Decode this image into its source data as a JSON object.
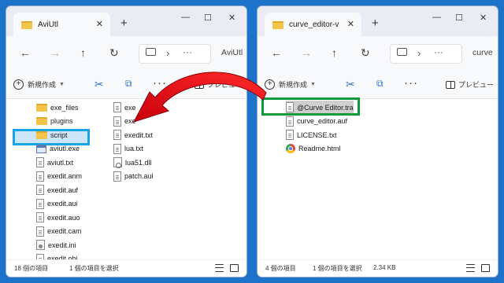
{
  "left_window": {
    "tab_title": "AviUtl",
    "address_text": "AviUtl",
    "toolbar": {
      "new_label": "新規作成",
      "preview_label": "プレビュー"
    },
    "files_col1": [
      {
        "name": "exe_files",
        "icon": "folder-icon"
      },
      {
        "name": "plugins",
        "icon": "folder-icon"
      },
      {
        "name": "script",
        "icon": "folder-icon"
      },
      {
        "name": "aviutl.exe",
        "icon": "exe-icon"
      },
      {
        "name": "aviutl.txt",
        "icon": "document-icon"
      },
      {
        "name": "exedit.anm",
        "icon": "document-icon"
      },
      {
        "name": "exedit.auf",
        "icon": "document-icon"
      },
      {
        "name": "exedit.aui",
        "icon": "document-icon"
      },
      {
        "name": "exedit.auo",
        "icon": "document-icon"
      },
      {
        "name": "exedit.cam",
        "icon": "document-icon"
      },
      {
        "name": "exedit.ini",
        "icon": "settings-file-icon"
      },
      {
        "name": "exedit.obj",
        "icon": "document-icon"
      }
    ],
    "files_col2": [
      {
        "name": "exe",
        "icon": "document-icon"
      },
      {
        "name": "exe",
        "icon": "document-icon"
      },
      {
        "name": "exedit.txt",
        "icon": "document-icon"
      },
      {
        "name": "lua.txt",
        "icon": "document-icon"
      },
      {
        "name": "lua51.dll",
        "icon": "dll-icon"
      },
      {
        "name": "patch.aul",
        "icon": "document-icon"
      }
    ],
    "status": {
      "count": "18 個の項目",
      "selected": "1 個の項目を選択"
    }
  },
  "right_window": {
    "tab_title": "curve_editor-v",
    "address_text": "curve",
    "toolbar": {
      "new_label": "新規作成",
      "preview_label": "プレビュー"
    },
    "files": [
      {
        "name": "@Curve Editor.tra",
        "icon": "document-icon"
      },
      {
        "name": "curve_editor.auf",
        "icon": "document-icon"
      },
      {
        "name": "LICENSE.txt",
        "icon": "document-icon"
      },
      {
        "name": "Readme.html",
        "icon": "chrome-icon"
      }
    ],
    "status": {
      "count": "4 個の項目",
      "selected": "1 個の項目を選択",
      "size": "2.34 KB"
    }
  },
  "colors": {
    "background": "#1c73c9",
    "arrow": "#e8101c",
    "highlight_target": "#18a5e6",
    "highlight_source": "#0e9a3a"
  }
}
